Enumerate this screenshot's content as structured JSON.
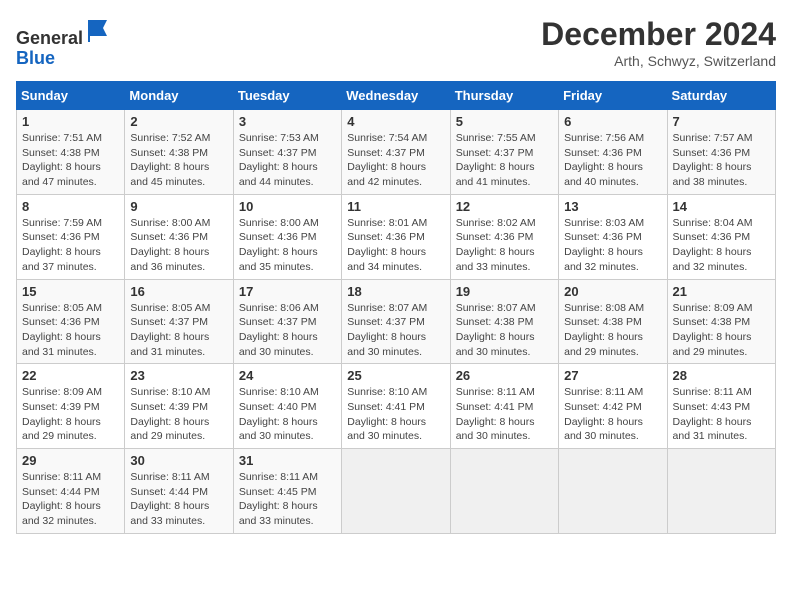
{
  "header": {
    "logo_line1": "General",
    "logo_line2": "Blue",
    "month": "December 2024",
    "location": "Arth, Schwyz, Switzerland"
  },
  "weekdays": [
    "Sunday",
    "Monday",
    "Tuesday",
    "Wednesday",
    "Thursday",
    "Friday",
    "Saturday"
  ],
  "weeks": [
    [
      {
        "day": "1",
        "sunrise": "7:51 AM",
        "sunset": "4:38 PM",
        "daylight": "8 hours and 47 minutes."
      },
      {
        "day": "2",
        "sunrise": "7:52 AM",
        "sunset": "4:38 PM",
        "daylight": "8 hours and 45 minutes."
      },
      {
        "day": "3",
        "sunrise": "7:53 AM",
        "sunset": "4:37 PM",
        "daylight": "8 hours and 44 minutes."
      },
      {
        "day": "4",
        "sunrise": "7:54 AM",
        "sunset": "4:37 PM",
        "daylight": "8 hours and 42 minutes."
      },
      {
        "day": "5",
        "sunrise": "7:55 AM",
        "sunset": "4:37 PM",
        "daylight": "8 hours and 41 minutes."
      },
      {
        "day": "6",
        "sunrise": "7:56 AM",
        "sunset": "4:36 PM",
        "daylight": "8 hours and 40 minutes."
      },
      {
        "day": "7",
        "sunrise": "7:57 AM",
        "sunset": "4:36 PM",
        "daylight": "8 hours and 38 minutes."
      }
    ],
    [
      {
        "day": "8",
        "sunrise": "7:59 AM",
        "sunset": "4:36 PM",
        "daylight": "8 hours and 37 minutes."
      },
      {
        "day": "9",
        "sunrise": "8:00 AM",
        "sunset": "4:36 PM",
        "daylight": "8 hours and 36 minutes."
      },
      {
        "day": "10",
        "sunrise": "8:00 AM",
        "sunset": "4:36 PM",
        "daylight": "8 hours and 35 minutes."
      },
      {
        "day": "11",
        "sunrise": "8:01 AM",
        "sunset": "4:36 PM",
        "daylight": "8 hours and 34 minutes."
      },
      {
        "day": "12",
        "sunrise": "8:02 AM",
        "sunset": "4:36 PM",
        "daylight": "8 hours and 33 minutes."
      },
      {
        "day": "13",
        "sunrise": "8:03 AM",
        "sunset": "4:36 PM",
        "daylight": "8 hours and 32 minutes."
      },
      {
        "day": "14",
        "sunrise": "8:04 AM",
        "sunset": "4:36 PM",
        "daylight": "8 hours and 32 minutes."
      }
    ],
    [
      {
        "day": "15",
        "sunrise": "8:05 AM",
        "sunset": "4:36 PM",
        "daylight": "8 hours and 31 minutes."
      },
      {
        "day": "16",
        "sunrise": "8:05 AM",
        "sunset": "4:37 PM",
        "daylight": "8 hours and 31 minutes."
      },
      {
        "day": "17",
        "sunrise": "8:06 AM",
        "sunset": "4:37 PM",
        "daylight": "8 hours and 30 minutes."
      },
      {
        "day": "18",
        "sunrise": "8:07 AM",
        "sunset": "4:37 PM",
        "daylight": "8 hours and 30 minutes."
      },
      {
        "day": "19",
        "sunrise": "8:07 AM",
        "sunset": "4:38 PM",
        "daylight": "8 hours and 30 minutes."
      },
      {
        "day": "20",
        "sunrise": "8:08 AM",
        "sunset": "4:38 PM",
        "daylight": "8 hours and 29 minutes."
      },
      {
        "day": "21",
        "sunrise": "8:09 AM",
        "sunset": "4:38 PM",
        "daylight": "8 hours and 29 minutes."
      }
    ],
    [
      {
        "day": "22",
        "sunrise": "8:09 AM",
        "sunset": "4:39 PM",
        "daylight": "8 hours and 29 minutes."
      },
      {
        "day": "23",
        "sunrise": "8:10 AM",
        "sunset": "4:39 PM",
        "daylight": "8 hours and 29 minutes."
      },
      {
        "day": "24",
        "sunrise": "8:10 AM",
        "sunset": "4:40 PM",
        "daylight": "8 hours and 30 minutes."
      },
      {
        "day": "25",
        "sunrise": "8:10 AM",
        "sunset": "4:41 PM",
        "daylight": "8 hours and 30 minutes."
      },
      {
        "day": "26",
        "sunrise": "8:11 AM",
        "sunset": "4:41 PM",
        "daylight": "8 hours and 30 minutes."
      },
      {
        "day": "27",
        "sunrise": "8:11 AM",
        "sunset": "4:42 PM",
        "daylight": "8 hours and 30 minutes."
      },
      {
        "day": "28",
        "sunrise": "8:11 AM",
        "sunset": "4:43 PM",
        "daylight": "8 hours and 31 minutes."
      }
    ],
    [
      {
        "day": "29",
        "sunrise": "8:11 AM",
        "sunset": "4:44 PM",
        "daylight": "8 hours and 32 minutes."
      },
      {
        "day": "30",
        "sunrise": "8:11 AM",
        "sunset": "4:44 PM",
        "daylight": "8 hours and 33 minutes."
      },
      {
        "day": "31",
        "sunrise": "8:11 AM",
        "sunset": "4:45 PM",
        "daylight": "8 hours and 33 minutes."
      },
      null,
      null,
      null,
      null
    ]
  ]
}
